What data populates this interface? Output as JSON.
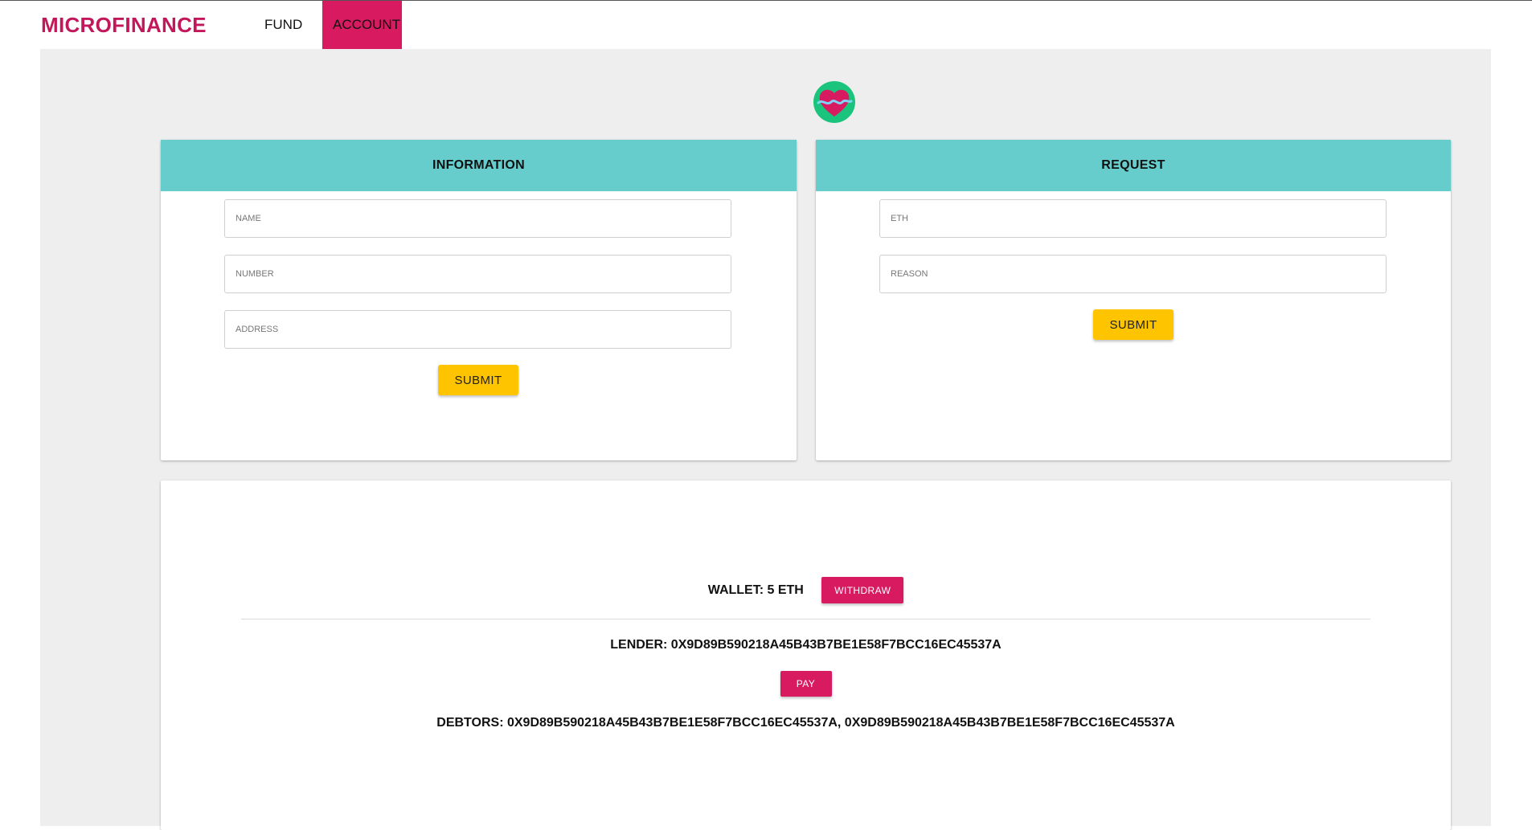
{
  "nav": {
    "brand": "MICROFINANCE",
    "items": [
      {
        "label": "FUND"
      },
      {
        "label": "ACCOUNT",
        "active": true
      }
    ]
  },
  "colors": {
    "brand": "#c2185b",
    "accent_pink": "#d81b60",
    "header_teal": "#67cdcc",
    "button_yellow": "#ffc400",
    "background": "#eeeeee"
  },
  "logo": {
    "icon": "heart-pulse-logo"
  },
  "information": {
    "title": "INFORMATION",
    "fields": {
      "name": {
        "placeholder": "NAME",
        "value": ""
      },
      "number": {
        "placeholder": "NUMBER",
        "value": ""
      },
      "address": {
        "placeholder": "ADDRESS",
        "value": ""
      }
    },
    "submit_label": "SUBMIT"
  },
  "request": {
    "title": "REQUEST",
    "fields": {
      "eth": {
        "placeholder": "ETH",
        "value": ""
      },
      "reason": {
        "placeholder": "REASON",
        "value": ""
      }
    },
    "submit_label": "SUBMIT"
  },
  "wallet": {
    "text": "WALLET: 5 ETH",
    "withdraw_label": "WITHDRAW",
    "lender": "LENDER: 0X9D89B590218A45B43B7BE1E58F7BCC16EC45537A",
    "pay_label": "PAY",
    "debtors": "DEBTORS: 0X9D89B590218A45B43B7BE1E58F7BCC16EC45537A, 0X9D89B590218A45B43B7BE1E58F7BCC16EC45537A"
  }
}
